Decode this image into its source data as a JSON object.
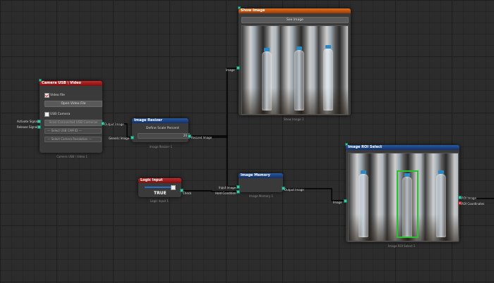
{
  "camera_node": {
    "title": "Camera USB \\ Video",
    "video_file_label": "Video file",
    "open_video_button": "Open Video File",
    "usb_camera_label": "USB Camera",
    "scan_button": "Scan Connected USB Cameras",
    "select_cam_placeholder": "--- Select USB CAM ID ---",
    "select_resolution_placeholder": "--- Select Camera Resolution ---",
    "inputs": [
      "Activate Signal",
      "Release Signal"
    ],
    "output": "Output Image",
    "caption": "Camera USB \\ Video 1",
    "video_file_checked": true,
    "usb_camera_checked": false
  },
  "resizer_node": {
    "title": "Image Resizer",
    "scale_label": "Define Scale Percent",
    "scale_value": "20",
    "input": "Generic Image",
    "output": "Resized Image",
    "caption": "Image Resizer 1"
  },
  "show_node": {
    "title": "Show Image",
    "see_button": "See Image",
    "input": "Image",
    "caption": "Show Image 1"
  },
  "logic_node": {
    "title": "Logic Input",
    "value": "TRUE",
    "output": "Check",
    "caption": "Logic Input 1"
  },
  "memory_node": {
    "title": "Image Memory",
    "inputs": [
      "Input Image",
      "Hold Condition"
    ],
    "output": "Output Image",
    "caption": "Image Memory 1"
  },
  "roi_node": {
    "title": "Image ROI Select",
    "input": "Image",
    "outputs": [
      "ROI Image",
      "ROI Coordinates"
    ],
    "caption": "Image ROI Select 1"
  },
  "colors": {
    "pin": "#39c8a8",
    "wire": "#000000",
    "roi_box": "#29c22c",
    "header_red": "#c22a2a",
    "header_blue": "#2a5aa0",
    "header_orange": "#e0701a"
  }
}
